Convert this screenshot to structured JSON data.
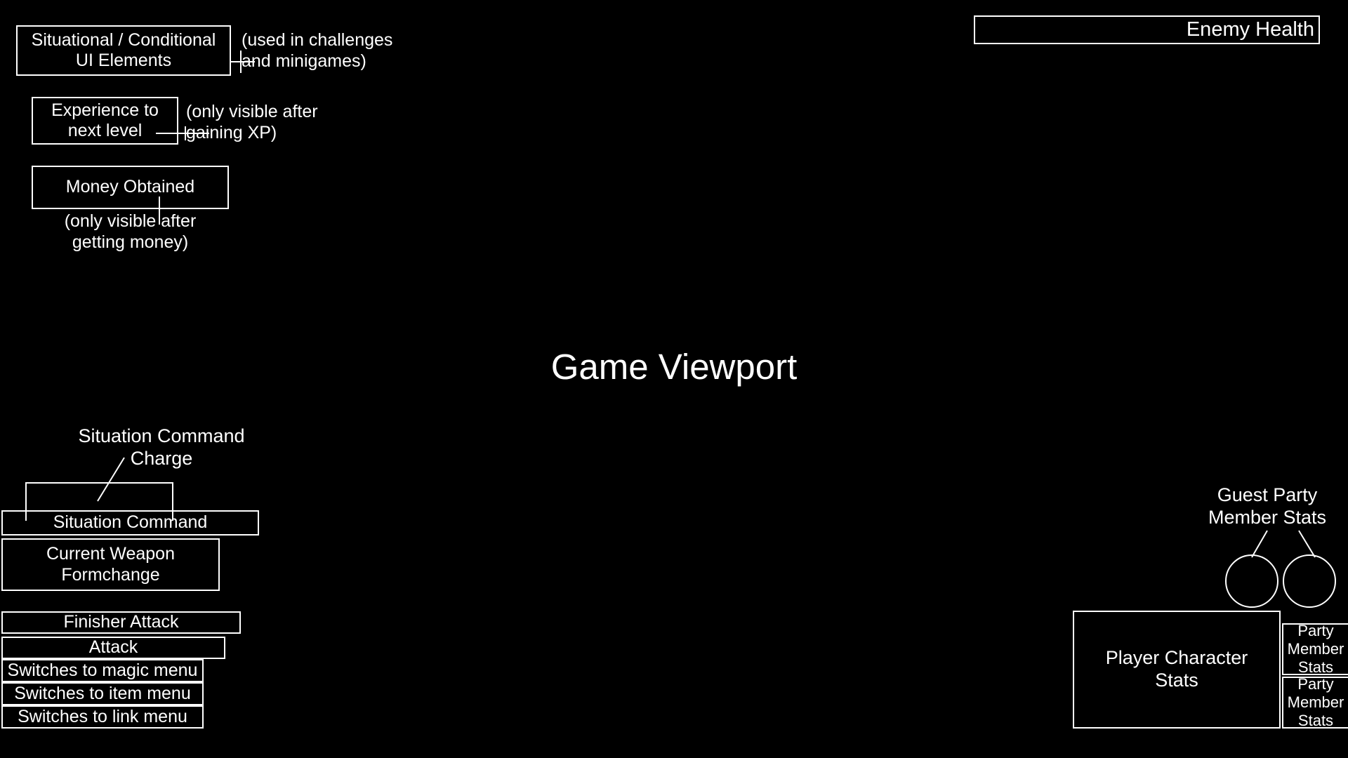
{
  "annotations": {
    "situational_ui": {
      "label": "Situational / Conditional\nUI Elements",
      "note": "(used in challenges\nand minigames)"
    },
    "experience": {
      "label": "Experience to\nnext level",
      "note": "(only visible after\ngaining XP)"
    },
    "money": {
      "label": "Money Obtained",
      "note": "(only visible after\ngetting money)"
    }
  },
  "enemy": {
    "health_label": "Enemy Health"
  },
  "viewport": {
    "title": "Game Viewport"
  },
  "command_menu": {
    "charge_label": "Situation Command\nCharge",
    "situation_command": "Situation Command",
    "weapon_formchange": "Current Weapon\nFormchange",
    "finisher_attack": "Finisher Attack",
    "attack": "Attack",
    "magic_menu": "Switches to magic menu",
    "item_menu": "Switches to item menu",
    "link_menu": "Switches to link menu"
  },
  "party": {
    "guest_label": "Guest Party\nMember Stats",
    "player_stats": "Player Character\nStats",
    "member_stats_1": "Party\nMember\nStats",
    "member_stats_2": "Party\nMember\nStats"
  },
  "colors": {
    "background": "#000000",
    "stroke": "#ffffff",
    "text": "#ffffff"
  }
}
